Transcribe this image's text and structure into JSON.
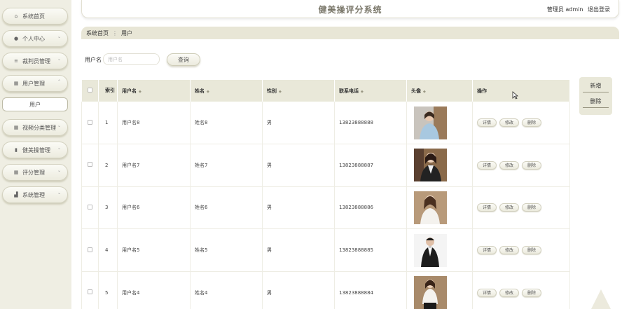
{
  "header": {
    "title": "健美操评分系统",
    "user_label": "管理员 admin",
    "logout": "退出登录"
  },
  "sidebar": {
    "items": [
      {
        "label": "系统首页",
        "icon": "home-icon"
      },
      {
        "label": "个人中心",
        "icon": "person-icon"
      },
      {
        "label": "裁判员管理",
        "icon": "list-icon"
      },
      {
        "label": "用户管理",
        "icon": "grid-icon",
        "expanded": true
      },
      {
        "label": "视频分类管理",
        "icon": "grid-icon"
      },
      {
        "label": "健美操管理",
        "icon": "clipboard-icon"
      },
      {
        "label": "评分管理",
        "icon": "grid-icon"
      },
      {
        "label": "系统管理",
        "icon": "bar-chart-icon"
      }
    ],
    "submenu": {
      "label": "用户"
    }
  },
  "breadcrumb": {
    "home": "系统首页",
    "sep": "⋮",
    "current": "用户"
  },
  "search": {
    "label": "用户名",
    "placeholder": "用户名",
    "button": "查询"
  },
  "right_panel": {
    "add": "新增",
    "delete": "删除"
  },
  "table": {
    "headers": {
      "index": "索引",
      "username": "用户名",
      "name": "姓名",
      "gender": "性别",
      "phone": "联系电话",
      "avatar": "头像",
      "actions": "操作"
    },
    "action_labels": {
      "detail": "详情",
      "edit": "修改",
      "delete": "删除"
    },
    "rows": [
      {
        "index": "1",
        "username": "用户名8",
        "name": "姓名8",
        "gender": "男",
        "phone": "13823888888"
      },
      {
        "index": "2",
        "username": "用户名7",
        "name": "姓名7",
        "gender": "男",
        "phone": "13823888887"
      },
      {
        "index": "3",
        "username": "用户名6",
        "name": "姓名6",
        "gender": "男",
        "phone": "13823888886"
      },
      {
        "index": "4",
        "username": "用户名5",
        "name": "姓名5",
        "gender": "男",
        "phone": "13823888885"
      },
      {
        "index": "5",
        "username": "用户名4",
        "name": "姓名4",
        "gender": "男",
        "phone": "13823888884"
      }
    ]
  }
}
